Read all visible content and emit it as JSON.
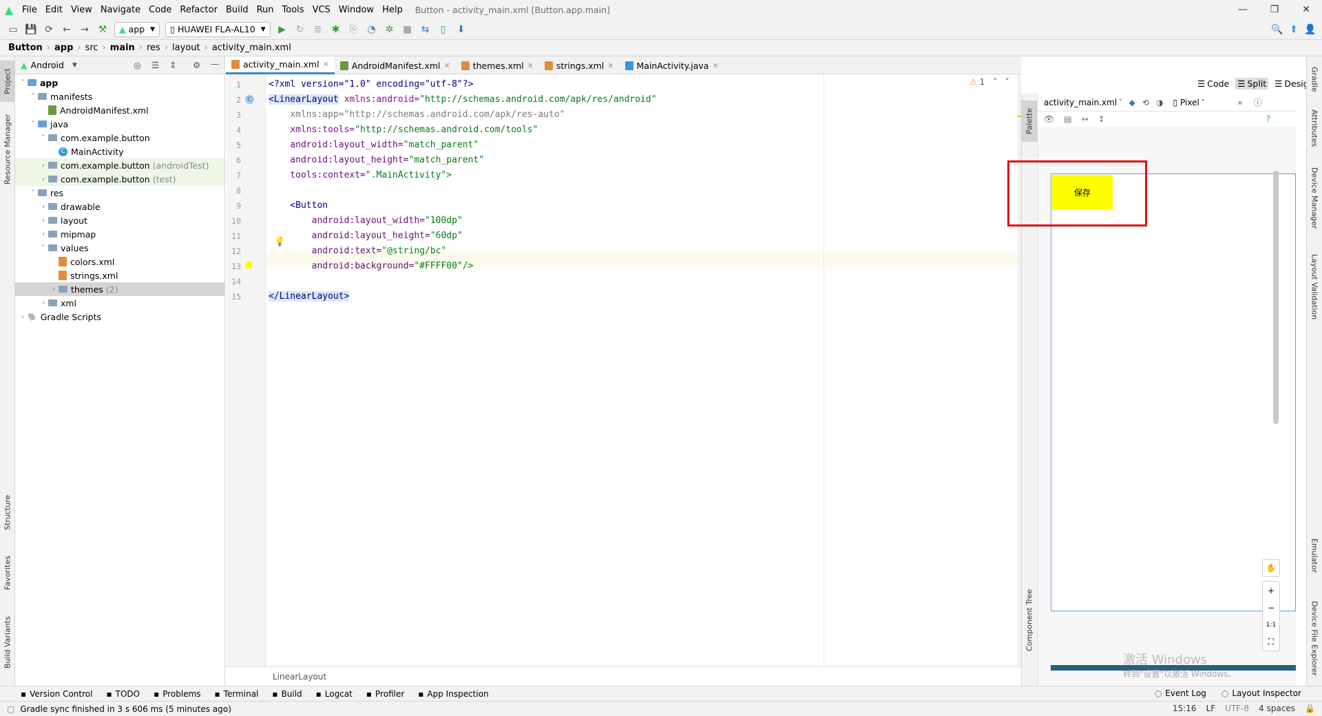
{
  "menubar": {
    "items": [
      "File",
      "Edit",
      "View",
      "Navigate",
      "Code",
      "Refactor",
      "Build",
      "Run",
      "Tools",
      "VCS",
      "Window",
      "Help"
    ],
    "window_title": "Button - activity_main.xml [Button.app.main]"
  },
  "toolbar": {
    "run_config": "app",
    "device": "HUAWEI FLA-AL10"
  },
  "breadcrumb": [
    "Button",
    "app",
    "src",
    "main",
    "res",
    "layout",
    "activity_main.xml"
  ],
  "left_tool_tabs": [
    "Project",
    "Resource Manager",
    "Structure",
    "Favorites",
    "Build Variants"
  ],
  "project": {
    "view_mode": "Android",
    "tree": [
      {
        "label": "app",
        "level": 0,
        "kind": "folder-blue",
        "arrow": "down",
        "bold": true
      },
      {
        "label": "manifests",
        "level": 1,
        "kind": "folder",
        "arrow": "down"
      },
      {
        "label": "AndroidManifest.xml",
        "level": 2,
        "kind": "manifest",
        "arrow": ""
      },
      {
        "label": "java",
        "level": 1,
        "kind": "folder-blue",
        "arrow": "down"
      },
      {
        "label": "com.example.button",
        "level": 2,
        "kind": "folder",
        "arrow": "down"
      },
      {
        "label": "MainActivity",
        "level": 3,
        "kind": "class",
        "arrow": ""
      },
      {
        "label": "com.example.button",
        "suffix": "(androidTest)",
        "level": 2,
        "kind": "folder",
        "arrow": "right",
        "highlight": "green"
      },
      {
        "label": "com.example.button",
        "suffix": "(test)",
        "level": 2,
        "kind": "folder",
        "arrow": "right",
        "highlight": "green"
      },
      {
        "label": "res",
        "level": 1,
        "kind": "folder",
        "arrow": "down"
      },
      {
        "label": "drawable",
        "level": 2,
        "kind": "folder",
        "arrow": "right"
      },
      {
        "label": "layout",
        "level": 2,
        "kind": "folder",
        "arrow": "right"
      },
      {
        "label": "mipmap",
        "level": 2,
        "kind": "folder",
        "arrow": "right"
      },
      {
        "label": "values",
        "level": 2,
        "kind": "folder",
        "arrow": "down"
      },
      {
        "label": "colors.xml",
        "level": 3,
        "kind": "xml",
        "arrow": ""
      },
      {
        "label": "strings.xml",
        "level": 3,
        "kind": "xml",
        "arrow": ""
      },
      {
        "label": "themes",
        "suffix": "(2)",
        "level": 3,
        "kind": "folder",
        "arrow": "right",
        "highlight": "selected"
      },
      {
        "label": "xml",
        "level": 2,
        "kind": "folder",
        "arrow": "right"
      },
      {
        "label": "Gradle Scripts",
        "level": 0,
        "kind": "gradle",
        "arrow": "right"
      }
    ]
  },
  "editor": {
    "tabs": [
      {
        "label": "activity_main.xml",
        "active": true,
        "icon_color": "#e28c3b"
      },
      {
        "label": "AndroidManifest.xml",
        "active": false,
        "icon_color": "#6a9a3a"
      },
      {
        "label": "themes.xml",
        "active": false,
        "icon_color": "#e28c3b"
      },
      {
        "label": "strings.xml",
        "active": false,
        "icon_color": "#e28c3b"
      },
      {
        "label": "MainActivity.java",
        "active": false,
        "icon_color": "#3a97d6"
      }
    ],
    "line_numbers": [
      "1",
      "2",
      "3",
      "4",
      "5",
      "6",
      "7",
      "8",
      "9",
      "10",
      "11",
      "12",
      "13",
      "14",
      "15"
    ],
    "warning_count": "1",
    "code_lines": [
      [
        {
          "t": "<?xml version=\"1.0\" encoding=\"utf-8\"?>",
          "c": "tag"
        }
      ],
      [
        {
          "t": "<LinearLayout",
          "c": "tag-hl"
        },
        {
          "t": " xmlns:android=",
          "c": "ns"
        },
        {
          "t": "\"http://schemas.android.com/apk/res/android\"",
          "c": "val"
        }
      ],
      [
        {
          "t": "    xmlns:app=\"http://schemas.android.com/apk/res-auto\"",
          "c": "gray"
        }
      ],
      [
        {
          "t": "    xmlns:tools=",
          "c": "ns"
        },
        {
          "t": "\"http://schemas.android.com/tools\"",
          "c": "val"
        }
      ],
      [
        {
          "t": "    android:layout_width=",
          "c": "attr"
        },
        {
          "t": "\"match_parent\"",
          "c": "val"
        }
      ],
      [
        {
          "t": "    android:layout_height=",
          "c": "attr"
        },
        {
          "t": "\"match_parent\"",
          "c": "val"
        }
      ],
      [
        {
          "t": "    tools:context=",
          "c": "attr"
        },
        {
          "t": "\".MainActivity\">",
          "c": "val"
        }
      ],
      [
        {
          "t": "",
          "c": "tag"
        }
      ],
      [
        {
          "t": "    <Button",
          "c": "tag"
        }
      ],
      [
        {
          "t": "        android:layout_width=",
          "c": "attr"
        },
        {
          "t": "\"100dp\"",
          "c": "val"
        }
      ],
      [
        {
          "t": "        android:layout_height=",
          "c": "attr"
        },
        {
          "t": "\"60dp\"",
          "c": "val"
        }
      ],
      [
        {
          "t": "        android:text=",
          "c": "attr"
        },
        {
          "t": "\"@string/bc\"",
          "c": "val"
        }
      ],
      [
        {
          "t": "        android:background=",
          "c": "attr"
        },
        {
          "t": "\"#FFFF00\"/>",
          "c": "val"
        }
      ],
      [
        {
          "t": "",
          "c": "tag"
        }
      ],
      [
        {
          "t": "</LinearLayout>",
          "c": "tag-hl"
        }
      ]
    ],
    "breadcrumb_bottom": "LinearLayout"
  },
  "design": {
    "view_modes": [
      "Code",
      "Split",
      "Design"
    ],
    "active_mode": "Split",
    "file_combo": "activity_main.xml",
    "device_combo": "Pixel",
    "palette_label": "Palette",
    "component_tree_label": "Component Tree",
    "preview_button_text": "保存",
    "preview_button_color": "#FFFF00",
    "zoom_label": "1:1",
    "watermark_line1": "激活 Windows",
    "watermark_line2": "转到\"设置\"以激活 Windows。"
  },
  "right_tool_tabs": [
    "Gradle",
    "Attributes",
    "Device Manager",
    "Layout Validation",
    "Emulator",
    "Device File Explorer"
  ],
  "bottom_tools": [
    "Version Control",
    "TODO",
    "Problems",
    "Terminal",
    "Build",
    "Logcat",
    "Profiler",
    "App Inspection"
  ],
  "bottom_tools_right": [
    "Event Log",
    "Layout Inspector"
  ],
  "status": {
    "message": "Gradle sync finished in 3 s 606 ms (5 minutes ago)",
    "position": "15:16",
    "line_sep": "LF",
    "encoding": "UTF-8",
    "indent": "4 spaces"
  },
  "colors": {
    "accent": "#4083c9",
    "highlight_red": "#e01010",
    "preview_yellow": "#FFFF00"
  }
}
